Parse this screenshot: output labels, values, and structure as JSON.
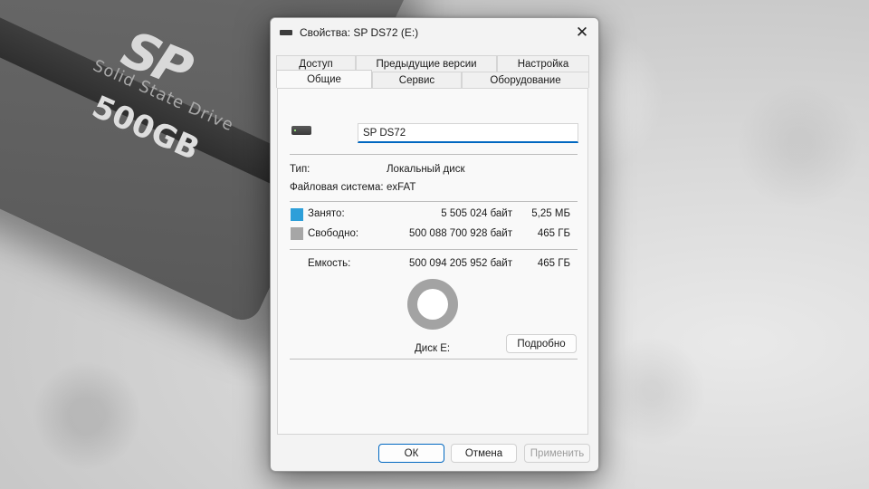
{
  "background": {
    "ssd_logo": "SP",
    "ssd_brand": "Solid State Drive",
    "ssd_capacity": "500GB"
  },
  "window": {
    "title": "Свойства: SP DS72 (E:)",
    "close_glyph": "✕"
  },
  "tabs": {
    "back_row": [
      "Доступ",
      "Предыдущие версии",
      "Настройка"
    ],
    "front_row": [
      "Общие",
      "Сервис",
      "Оборудование"
    ],
    "active": "Общие"
  },
  "general": {
    "drive_name_value": "SP DS72",
    "type_label": "Тип:",
    "type_value": "Локальный диск",
    "fs_label": "Файловая система:",
    "fs_value": "exFAT",
    "used_label": "Занято:",
    "used_bytes": "5 505 024 байт",
    "used_size": "5,25 МБ",
    "free_label": "Свободно:",
    "free_bytes": "500 088 700 928 байт",
    "free_size": "465 ГБ",
    "capacity_label": "Емкость:",
    "capacity_bytes": "500 094 205 952 байт",
    "capacity_size": "465 ГБ",
    "disk_label": "Диск E:",
    "details_button": "Подробно"
  },
  "colors": {
    "used": "#2d9fd9",
    "free": "#a6a6a6",
    "accent": "#0067c0"
  },
  "footer": {
    "ok": "ОК",
    "cancel": "Отмена",
    "apply": "Применить"
  }
}
